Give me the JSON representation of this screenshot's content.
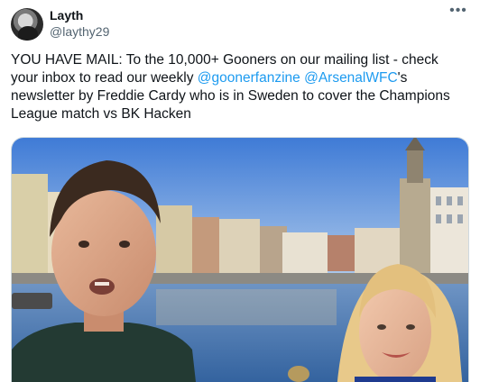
{
  "author": {
    "display_name": "Layth",
    "handle": "@laythy29"
  },
  "tweet": {
    "text_part1": "YOU HAVE MAIL: To the 10,000+ Gooners on our mailing list - check your inbox to read our weekly ",
    "mention1": "@goonerfanzine",
    "text_part2": " ",
    "mention2": "@ArsenalWFC",
    "text_part3": "'s newsletter by Freddie Cardy who is in Sweden to cover the Champions League match vs BK Hacken"
  },
  "icons": {
    "more": "more-options-icon",
    "avatar": "profile-avatar"
  },
  "colors": {
    "link": "#1d9bf0",
    "secondary_text": "#536471",
    "sky": "#5b8fd6",
    "water": "#3f6aa3"
  }
}
